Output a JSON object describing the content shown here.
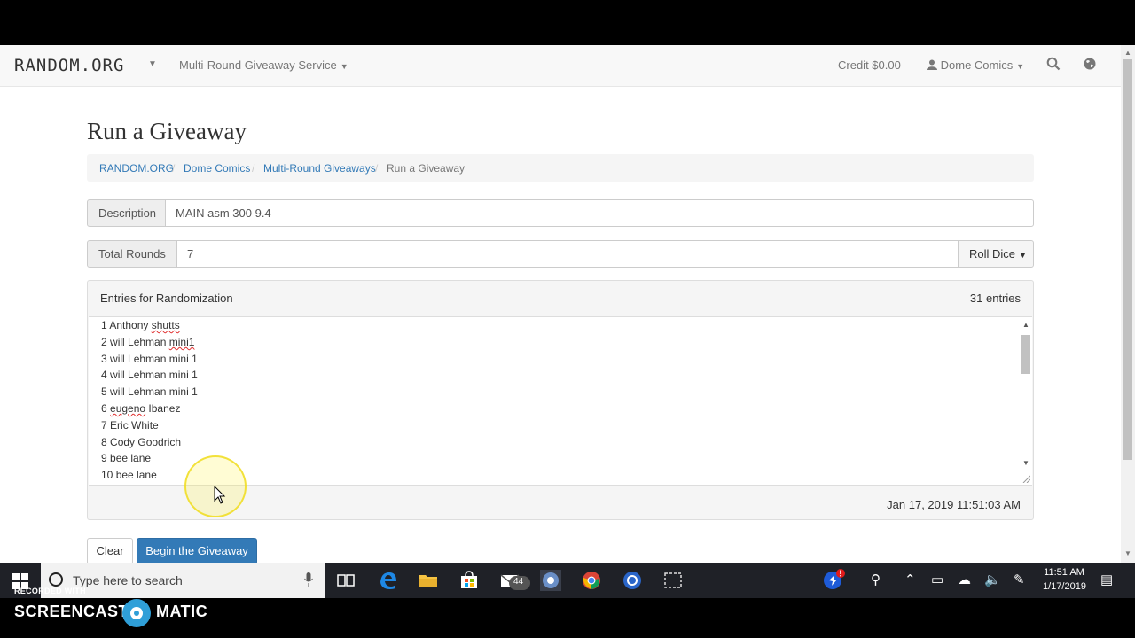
{
  "navbar": {
    "brand": "RANDOM.ORG",
    "service_menu": "Multi-Round Giveaway Service",
    "credit": "Credit $0.00",
    "user": "Dome Comics",
    "search_icon": "search-icon",
    "globe_icon": "globe-icon"
  },
  "page": {
    "title": "Run a Giveaway",
    "breadcrumb": [
      "RANDOM.ORG",
      "Dome Comics",
      "Multi-Round Giveaways",
      "Run a Giveaway"
    ]
  },
  "form": {
    "description_label": "Description",
    "description_value": "MAIN asm 300 9.4",
    "rounds_label": "Total Rounds",
    "rounds_value": "7",
    "roll_dice_label": "Roll Dice"
  },
  "entries": {
    "title": "Entries for Randomization",
    "count": "31 entries",
    "items": [
      {
        "num": "1",
        "pre": "Anthony ",
        "squiggle": "shutts",
        "post": ""
      },
      {
        "num": "2",
        "pre": "will Lehman ",
        "squiggle": "mini1",
        "post": ""
      },
      {
        "num": "3",
        "pre": "will Lehman mini 1",
        "squiggle": "",
        "post": ""
      },
      {
        "num": "4",
        "pre": "will Lehman mini 1",
        "squiggle": "",
        "post": ""
      },
      {
        "num": "5",
        "pre": "will Lehman mini 1",
        "squiggle": "",
        "post": ""
      },
      {
        "num": "6",
        "pre": "",
        "squiggle": "eugeno",
        "post": " Ibanez"
      },
      {
        "num": "7",
        "pre": "Eric White",
        "squiggle": "",
        "post": ""
      },
      {
        "num": "8",
        "pre": "Cody Goodrich",
        "squiggle": "",
        "post": ""
      },
      {
        "num": "9",
        "pre": "bee lane",
        "squiggle": "",
        "post": ""
      },
      {
        "num": "10",
        "pre": "bee lane",
        "squiggle": "",
        "post": ""
      }
    ],
    "timestamp": "Jan 17, 2019 11:51:03 AM"
  },
  "actions": {
    "clear": "Clear",
    "begin": "Begin the Giveaway"
  },
  "taskbar": {
    "search_placeholder": "Type here to search",
    "mail_badge": "44",
    "time": "11:51 AM",
    "date": "1/17/2019"
  },
  "watermark": {
    "recorded_with": "RECORDED WITH",
    "brand_left": "SCREENCAST",
    "brand_right": "MATIC"
  },
  "colors": {
    "link": "#337ab7",
    "primary_button": "#337ab7",
    "taskbar": "#1f2127"
  }
}
